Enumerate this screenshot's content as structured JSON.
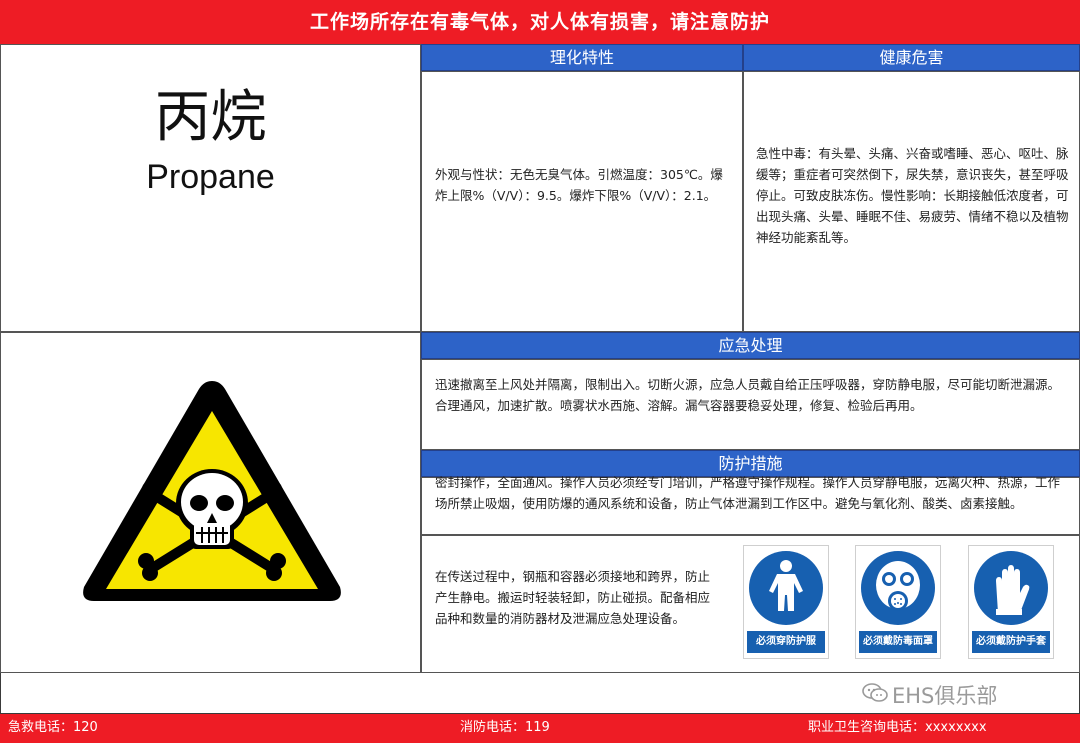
{
  "header": {
    "title": "工作场所存在有毒气体，对人体有损害，请注意防护"
  },
  "substance": {
    "name_cn": "丙烷",
    "name_en": "Propane"
  },
  "sections": {
    "physical_chemical": {
      "title": "理化特性",
      "text": "外观与性状：无色无臭气体。引燃温度：305℃。爆炸上限%（V/V）：9.5。爆炸下限%（V/V）：2.1。"
    },
    "health_hazard": {
      "title": "健康危害",
      "text": "急性中毒：有头晕、头痛、兴奋或嗜睡、恶心、呕吐、脉缓等；重症者可突然倒下，尿失禁，意识丧失，甚至呼吸停止。可致皮肤冻伤。慢性影响：长期接触低浓度者，可出现头痛、头晕、睡眠不佳、易疲劳、情绪不稳以及植物神经功能紊乱等。"
    },
    "emergency": {
      "title": "应急处理",
      "text": "迅速撤离至上风处并隔离，限制出入。切断火源，应急人员戴自给正压呼吸器，穿防静电服，尽可能切断泄漏源。合理通风，加速扩散。喷雾状水西施、溶解。漏气容器要稳妥处理，修复、检验后再用。"
    },
    "protection": {
      "title": "防护措施",
      "text": "密封操作，全面通风。操作人员必须经专门培训，严格遵守操作规程。操作人员穿静电服，远离火种、热源，工作场所禁止吸烟，使用防爆的通风系统和设备，防止气体泄漏到工作区中。避免与氧化剂、酸类、卤素接触。",
      "transport_text": "在传送过程中，钢瓶和容器必须接地和跨界，防止产生静电。搬运时轻装轻卸，防止碰损。配备相应品种和数量的消防器材及泄漏应急处理设备。"
    }
  },
  "ppe_signs": [
    {
      "label": "必须穿防护服",
      "icon": "protective-suit-icon"
    },
    {
      "label": "必须戴防毒面罩",
      "icon": "gas-mask-icon"
    },
    {
      "label": "必须戴防护手套",
      "icon": "protective-gloves-icon"
    }
  ],
  "warning_sign": {
    "icon": "toxic-skull-crossbones-icon",
    "colors": {
      "fill": "#f7e600",
      "border": "#000000"
    }
  },
  "watermark": {
    "text": "EHS俱乐部"
  },
  "footer": {
    "emergency_phone": "急救电话：120",
    "fire_phone": "消防电话：119",
    "occupational_health_phone": "职业卫生咨询电话：xxxxxxxx"
  },
  "colors": {
    "banner_red": "#ee1c25",
    "section_blue": "#2d63c8",
    "sign_blue": "#1760b0"
  }
}
